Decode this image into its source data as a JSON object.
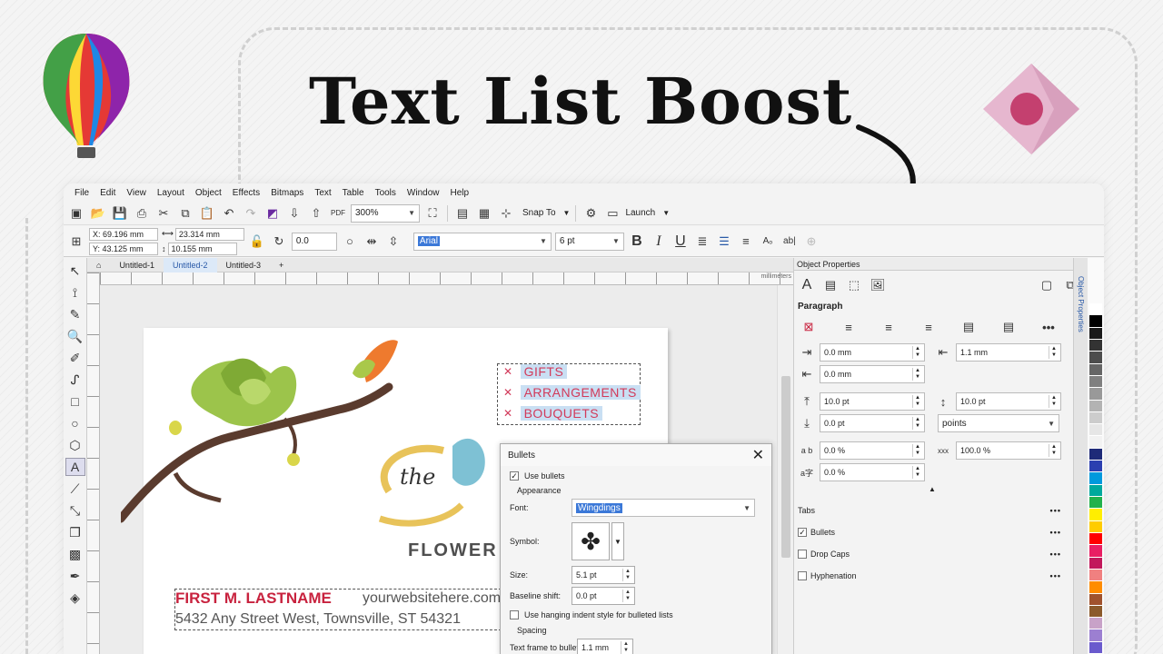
{
  "headline": "Text List Boost",
  "menu": [
    "File",
    "Edit",
    "View",
    "Layout",
    "Object",
    "Effects",
    "Bitmaps",
    "Text",
    "Table",
    "Tools",
    "Window",
    "Help"
  ],
  "toolbar": {
    "zoom": "300%",
    "snap": "Snap To",
    "launch": "Launch"
  },
  "propbar": {
    "x": "X: 69.196 mm",
    "y": "Y: 43.125 mm",
    "w": "23.314 mm",
    "h": "10.155 mm",
    "angle": "0.0",
    "font": "Arial",
    "size": "6 pt"
  },
  "tabs": [
    "Untitled-1",
    "Untitled-2",
    "Untitled-3"
  ],
  "ruler_unit": "millimeters",
  "document": {
    "list": [
      "GIFTS",
      "ARRANGEMENTS",
      "BOUQUETS"
    ],
    "the": "the",
    "flower": "FLOWER",
    "name": "FIRST M. LASTNAME",
    "website": "yourwebsitehere.com",
    "address": "5432 Any Street West, Townsville, ST  54321"
  },
  "dialog": {
    "title": "Bullets",
    "use_bullets": "Use bullets",
    "appearance": "Appearance",
    "font_label": "Font:",
    "font_value": "Wingdings",
    "symbol_label": "Symbol:",
    "size_label": "Size:",
    "size_value": "5.1 pt",
    "baseline_label": "Baseline shift:",
    "baseline_value": "0.0 pt",
    "hanging": "Use hanging indent style for bulleted lists",
    "spacing": "Spacing",
    "frame_label": "Text frame to bullet:",
    "frame_value": "1.1 mm"
  },
  "props": {
    "title": "Object Properties",
    "paragraph": "Paragraph",
    "left_indent": "0.0 mm",
    "first_indent": "1.1 mm",
    "right_indent": "0.0 mm",
    "before": "10.0 pt",
    "line": "10.0 pt",
    "after": "0.0 pt",
    "units": "points",
    "char_spacing": "0.0 %",
    "word_spacing": "100.0 %",
    "lang_spacing": "0.0 %",
    "tabs": "Tabs",
    "bullets": "Bullets",
    "drop_caps": "Drop Caps",
    "hyphenation": "Hyphenation",
    "vtab": "Object Properties"
  },
  "palette_colors": [
    "#ffffff",
    "#000000",
    "#1a1a1a",
    "#333333",
    "#4d4d4d",
    "#666666",
    "#808080",
    "#999999",
    "#b3b3b3",
    "#cccccc",
    "#e6e6e6",
    "#f2f2f2",
    "#1e2a78",
    "#2b3fb0",
    "#0099dd",
    "#00a99d",
    "#22b14c",
    "#ffee00",
    "#ffcc00",
    "#ff0000",
    "#e91e63",
    "#c2185b",
    "#f08080",
    "#ff8c00",
    "#a0522d",
    "#8b5a2b",
    "#c8a2c8",
    "#9c7fd1",
    "#6a5acd"
  ]
}
